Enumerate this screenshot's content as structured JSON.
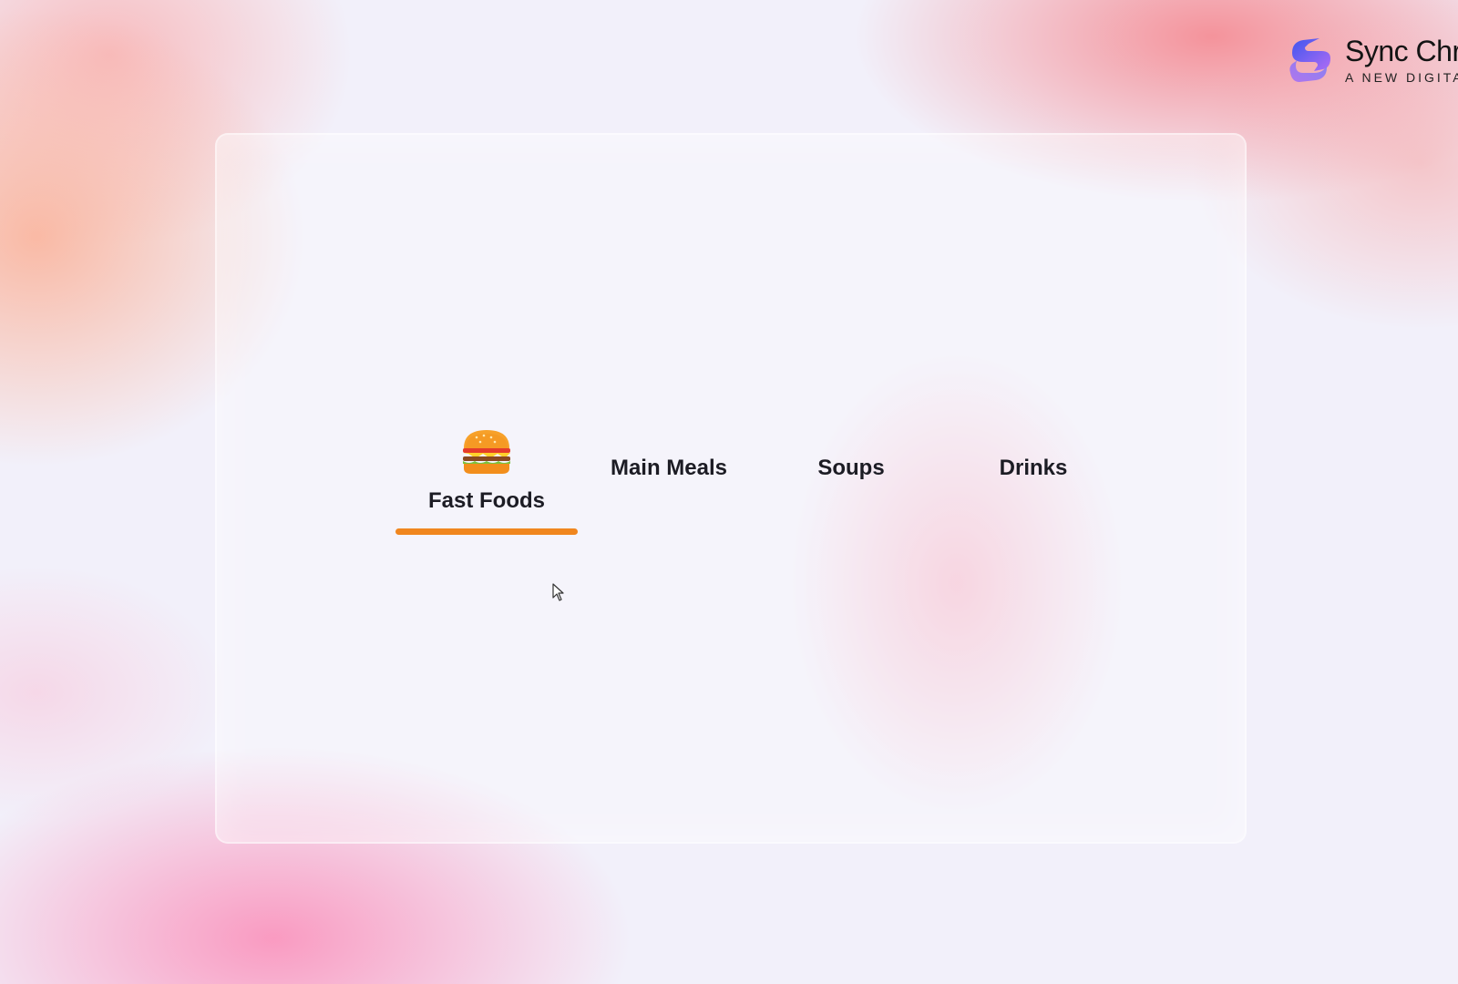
{
  "brand": {
    "name": "Sync Chr",
    "tagline": "A NEW DIGITA",
    "icon": "sync-logo-icon",
    "colors": {
      "gradient_start": "#4f5cf0",
      "gradient_end": "#b06cf5"
    }
  },
  "tabs": [
    {
      "label": "Fast Foods",
      "icon": "burger-icon",
      "active": true
    },
    {
      "label": "Main Meals",
      "active": false
    },
    {
      "label": "Soups",
      "active": false
    },
    {
      "label": "Drinks",
      "active": false
    }
  ],
  "accent_color": "#f0861e"
}
